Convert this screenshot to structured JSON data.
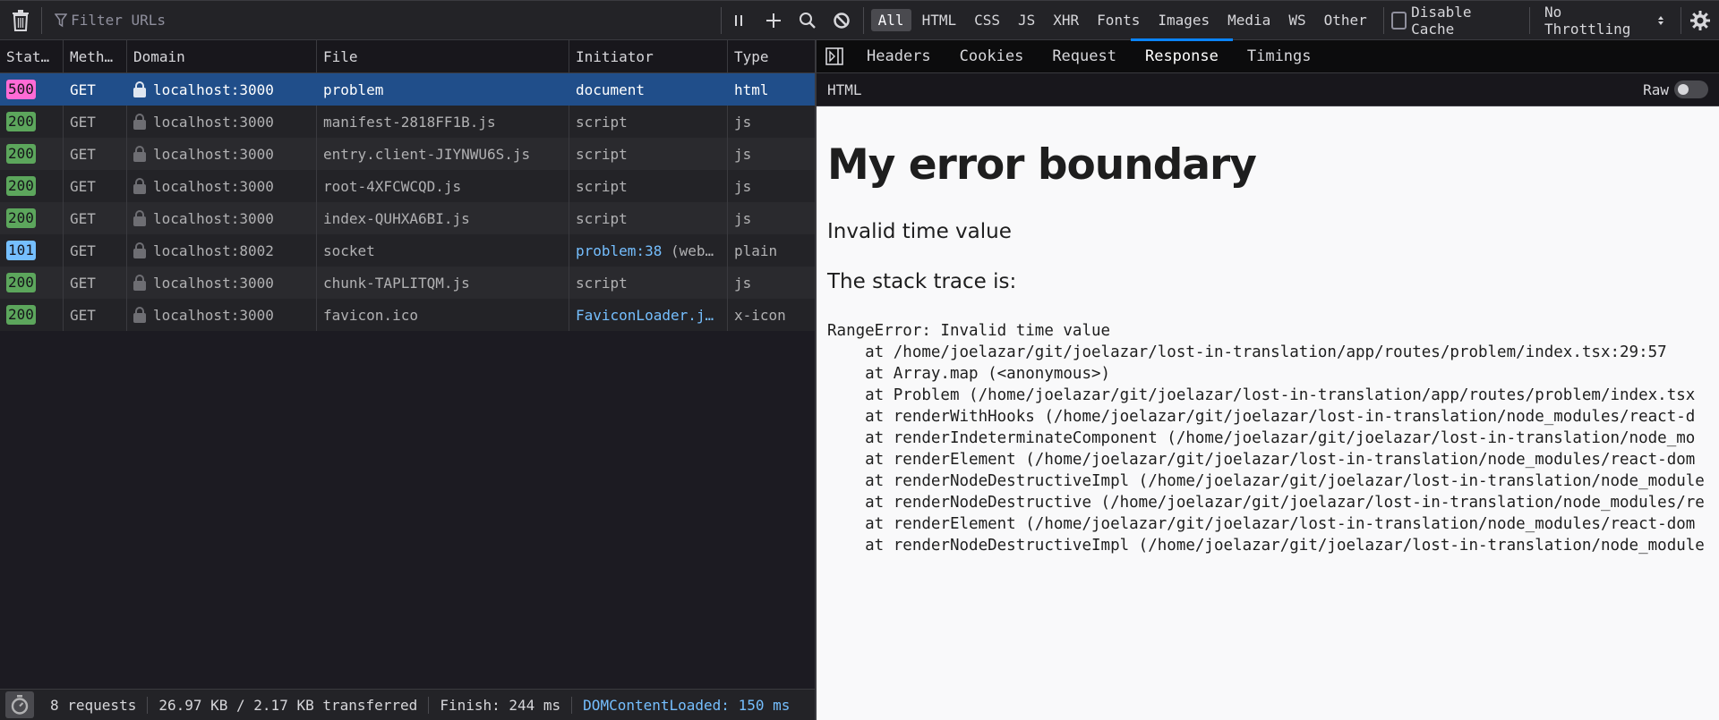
{
  "toolbar": {
    "filter_placeholder": "Filter URLs",
    "type_filters": [
      "All",
      "HTML",
      "CSS",
      "JS",
      "XHR",
      "Fonts",
      "Images",
      "Media",
      "WS",
      "Other"
    ],
    "active_filter": "All",
    "disable_cache_label": "Disable Cache",
    "throttling_label": "No Throttling",
    "icons": [
      "trash-icon",
      "filter-icon",
      "pause-icon",
      "plus-icon",
      "search-icon",
      "block-icon",
      "gear-icon"
    ]
  },
  "table": {
    "columns": [
      "Stat…",
      "Meth…",
      "Domain",
      "File",
      "Initiator",
      "Type"
    ],
    "rows": [
      {
        "status": "500",
        "status_color": "#ff6bd6",
        "method": "GET",
        "domain": "localhost:3000",
        "file": "problem",
        "initiator": "document",
        "initiator_link": "",
        "initiator_extra": "",
        "type": "html",
        "selected": true
      },
      {
        "status": "200",
        "status_color": "#5ca65c",
        "method": "GET",
        "domain": "localhost:3000",
        "file": "manifest-2818FF1B.js",
        "initiator": "script",
        "initiator_link": "",
        "initiator_extra": "",
        "type": "js",
        "selected": false
      },
      {
        "status": "200",
        "status_color": "#5ca65c",
        "method": "GET",
        "domain": "localhost:3000",
        "file": "entry.client-JIYNWU6S.js",
        "initiator": "script",
        "initiator_link": "",
        "initiator_extra": "",
        "type": "js",
        "selected": false
      },
      {
        "status": "200",
        "status_color": "#5ca65c",
        "method": "GET",
        "domain": "localhost:3000",
        "file": "root-4XFCWCQD.js",
        "initiator": "script",
        "initiator_link": "",
        "initiator_extra": "",
        "type": "js",
        "selected": false
      },
      {
        "status": "200",
        "status_color": "#5ca65c",
        "method": "GET",
        "domain": "localhost:3000",
        "file": "index-QUHXA6BI.js",
        "initiator": "script",
        "initiator_link": "",
        "initiator_extra": "",
        "type": "js",
        "selected": false
      },
      {
        "status": "101",
        "status_color": "#75bfff",
        "method": "GET",
        "domain": "localhost:8002",
        "file": "socket",
        "initiator": "",
        "initiator_link": "problem:38",
        "initiator_extra": " (web…",
        "type": "plain",
        "selected": false
      },
      {
        "status": "200",
        "status_color": "#5ca65c",
        "method": "GET",
        "domain": "localhost:3000",
        "file": "chunk-TAPLITQM.js",
        "initiator": "script",
        "initiator_link": "",
        "initiator_extra": "",
        "type": "js",
        "selected": false
      },
      {
        "status": "200",
        "status_color": "#5ca65c",
        "method": "GET",
        "domain": "localhost:3000",
        "file": "favicon.ico",
        "initiator": "",
        "initiator_link": "FaviconLoader.j…",
        "initiator_extra": "",
        "type": "x-icon",
        "selected": false
      }
    ]
  },
  "statusbar": {
    "requests": "8 requests",
    "transferred": "26.97 KB / 2.17 KB transferred",
    "finish": "Finish: 244 ms",
    "dom_content_loaded": "DOMContentLoaded: 150 ms"
  },
  "details": {
    "tabs": [
      "Headers",
      "Cookies",
      "Request",
      "Response",
      "Timings"
    ],
    "active_tab": "Response",
    "subheader_label": "HTML",
    "raw_label": "Raw",
    "raw_enabled": false,
    "response": {
      "heading": "My error boundary",
      "message": "Invalid time value",
      "stack_label": "The stack trace is:",
      "stack_trace": "RangeError: Invalid time value\n    at /home/joelazar/git/joelazar/lost-in-translation/app/routes/problem/index.tsx:29:57\n    at Array.map (<anonymous>)\n    at Problem (/home/joelazar/git/joelazar/lost-in-translation/app/routes/problem/index.tsx\n    at renderWithHooks (/home/joelazar/git/joelazar/lost-in-translation/node_modules/react-d\n    at renderIndeterminateComponent (/home/joelazar/git/joelazar/lost-in-translation/node_mo\n    at renderElement (/home/joelazar/git/joelazar/lost-in-translation/node_modules/react-dom\n    at renderNodeDestructiveImpl (/home/joelazar/git/joelazar/lost-in-translation/node_module\n    at renderNodeDestructive (/home/joelazar/git/joelazar/lost-in-translation/node_modules/re\n    at renderElement (/home/joelazar/git/joelazar/lost-in-translation/node_modules/react-dom\n    at renderNodeDestructiveImpl (/home/joelazar/git/joelazar/lost-in-translation/node_module"
    }
  }
}
